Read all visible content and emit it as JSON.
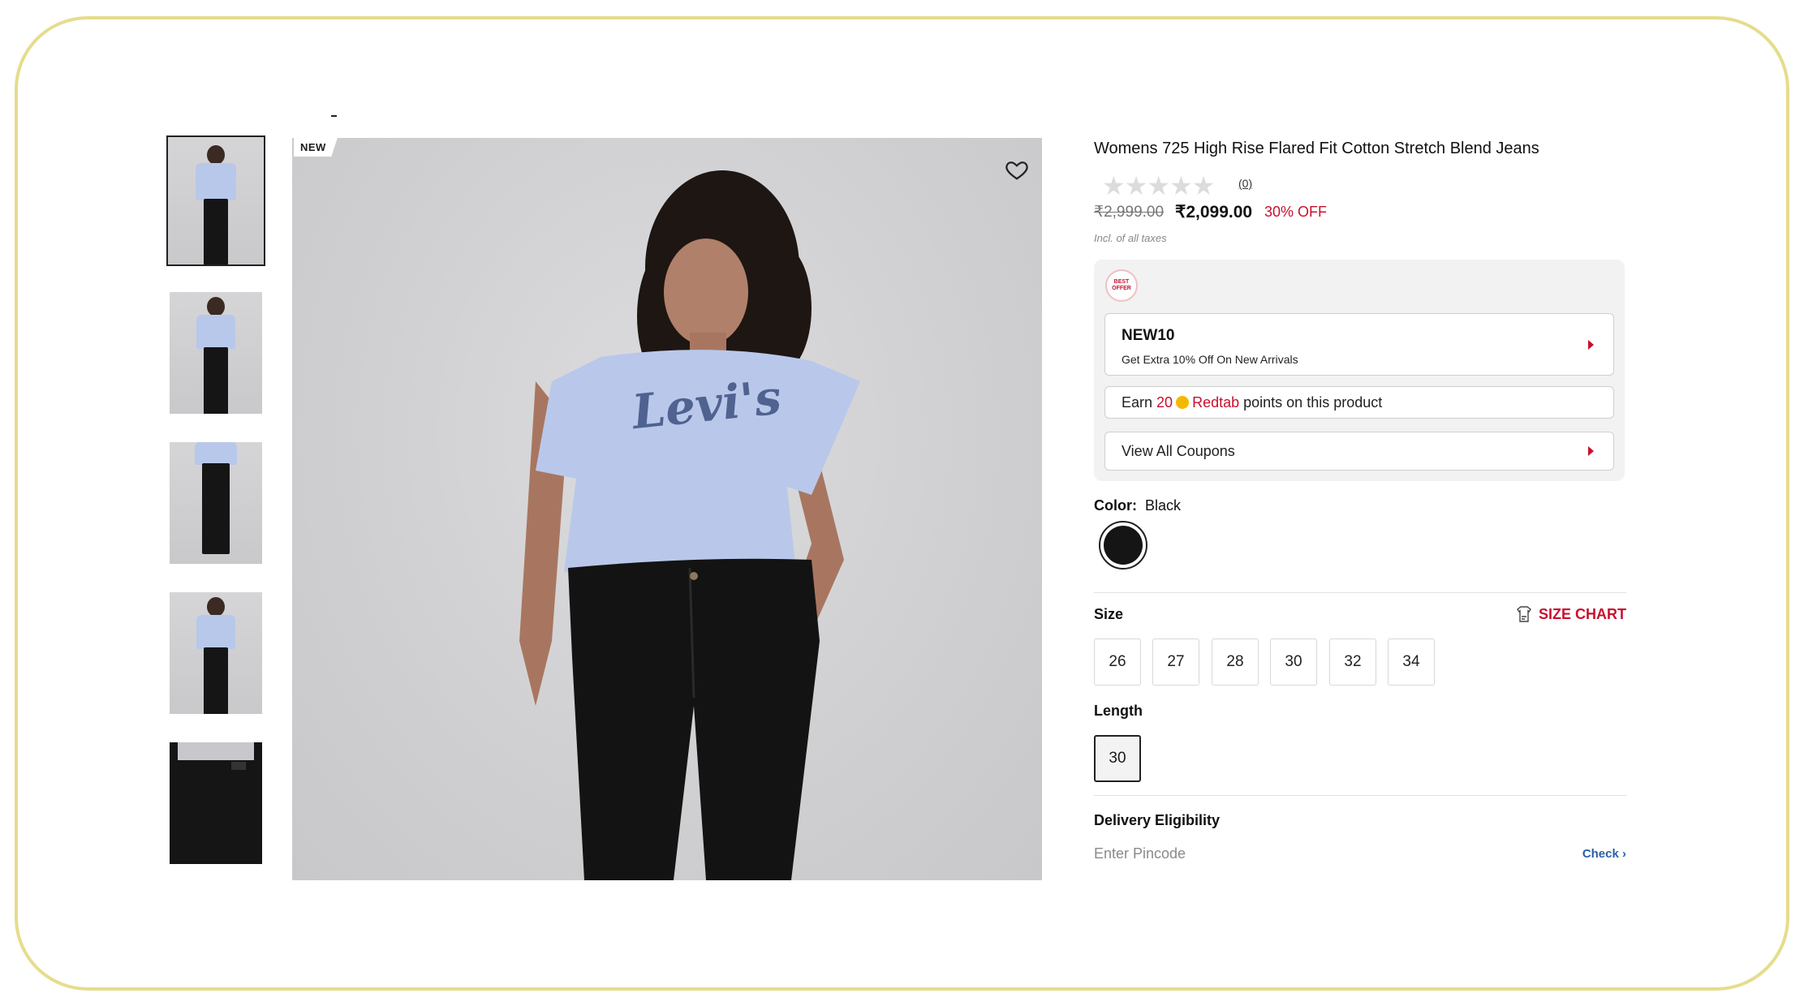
{
  "badge": {
    "new": "NEW"
  },
  "product": {
    "title": "Womens 725 High Rise Flared Fit Cotton Stretch Blend Jeans",
    "rating": {
      "stars": "★★★★★",
      "count": "(0)",
      "value": 0
    },
    "mrp": "₹2,999.00",
    "price": "₹2,099.00",
    "discount": "30% OFF",
    "taxes_note": "Incl. of all taxes"
  },
  "offers": {
    "badge_text": "BEST OFFER",
    "coupon": {
      "code": "NEW10",
      "description": "Get Extra 10% Off On New Arrivals"
    },
    "earn": {
      "prefix": "Earn",
      "points": "20",
      "brand": "Redtab",
      "suffix": "points on this product"
    },
    "view_all": "View All Coupons"
  },
  "color": {
    "label": "Color:",
    "selected": "Black",
    "swatch_hex": "#151515"
  },
  "size": {
    "label": "Size",
    "chart_link": "SIZE CHART",
    "options": [
      "26",
      "27",
      "28",
      "30",
      "32",
      "34"
    ]
  },
  "length": {
    "label": "Length",
    "selected": "30"
  },
  "delivery": {
    "label": "Delivery Eligibility",
    "placeholder": "Enter Pincode",
    "check": "Check ›"
  },
  "colors": {
    "accent": "#c8102e",
    "link": "#2a5fa8",
    "frame": "#e6dc8c"
  }
}
